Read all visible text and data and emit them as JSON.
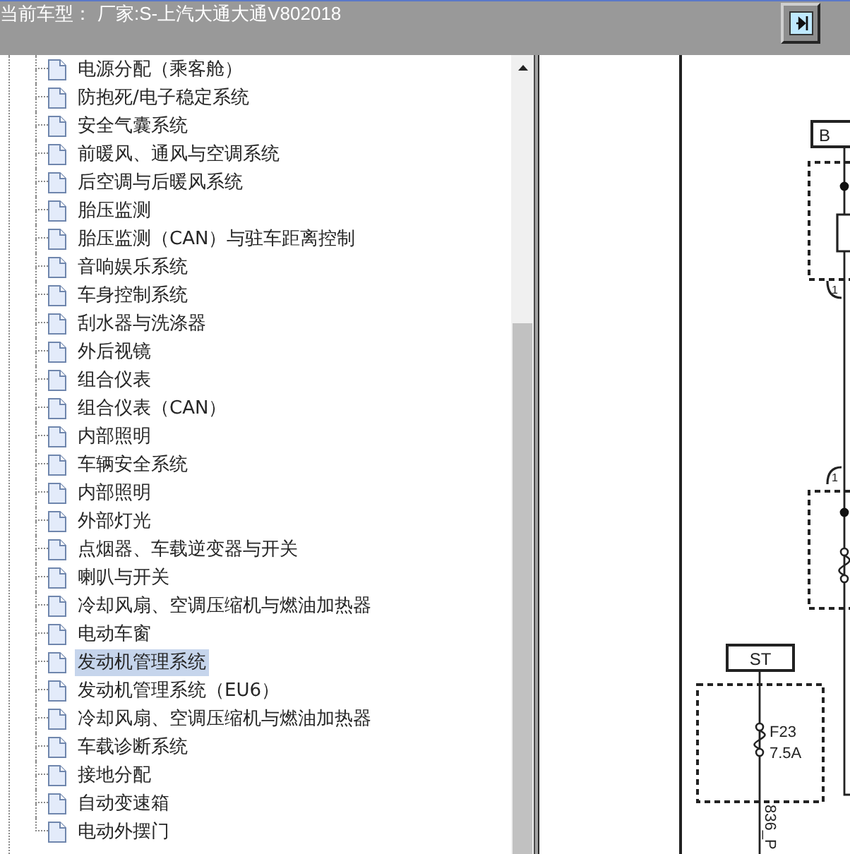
{
  "header": {
    "label": "当前车型：",
    "model": "厂家:S-上汽大通大通V802018"
  },
  "tree": {
    "items": [
      {
        "label": "电源分配（乘客舱）",
        "selected": false
      },
      {
        "label": "防抱死/电子稳定系统",
        "selected": false
      },
      {
        "label": "安全气囊系统",
        "selected": false
      },
      {
        "label": "前暖风、通风与空调系统",
        "selected": false
      },
      {
        "label": "后空调与后暖风系统",
        "selected": false
      },
      {
        "label": "胎压监测",
        "selected": false
      },
      {
        "label": "胎压监测（CAN）与驻车距离控制",
        "selected": false
      },
      {
        "label": "音响娱乐系统",
        "selected": false
      },
      {
        "label": "车身控制系统",
        "selected": false
      },
      {
        "label": "刮水器与洗涤器",
        "selected": false
      },
      {
        "label": "外后视镜",
        "selected": false
      },
      {
        "label": "组合仪表",
        "selected": false
      },
      {
        "label": "组合仪表（CAN）",
        "selected": false
      },
      {
        "label": "内部照明",
        "selected": false
      },
      {
        "label": "车辆安全系统",
        "selected": false
      },
      {
        "label": "内部照明",
        "selected": false
      },
      {
        "label": "外部灯光",
        "selected": false
      },
      {
        "label": "点烟器、车载逆变器与开关",
        "selected": false
      },
      {
        "label": "喇叭与开关",
        "selected": false
      },
      {
        "label": "冷却风扇、空调压缩机与燃油加热器",
        "selected": false
      },
      {
        "label": "电动车窗",
        "selected": false
      },
      {
        "label": "发动机管理系统",
        "selected": true
      },
      {
        "label": "发动机管理系统（EU6）",
        "selected": false
      },
      {
        "label": "冷却风扇、空调压缩机与燃油加热器",
        "selected": false
      },
      {
        "label": "车载诊断系统",
        "selected": false
      },
      {
        "label": "接地分配",
        "selected": false
      },
      {
        "label": "自动变速箱",
        "selected": false
      },
      {
        "label": "电动外摆门",
        "selected": false
      }
    ]
  },
  "diagram": {
    "terminals": [
      {
        "label": "B"
      },
      {
        "label": "ST"
      }
    ],
    "connectors": [
      {
        "pin": "1"
      },
      {
        "pin": "1"
      }
    ],
    "fuses": [
      {
        "name": "F23",
        "rating": "7.5A"
      }
    ],
    "wire_labels": [
      "836_P"
    ]
  }
}
